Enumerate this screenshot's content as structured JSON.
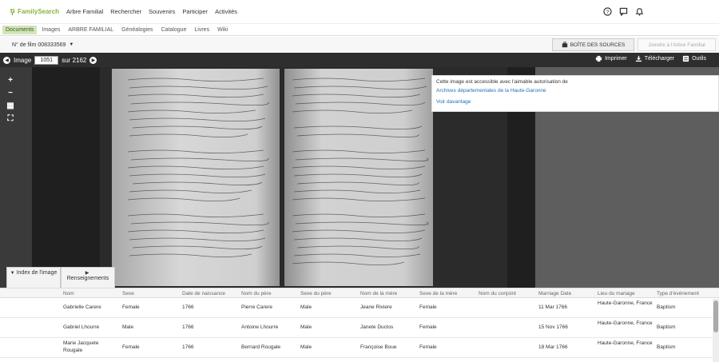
{
  "brand": {
    "name": "FamilySearch",
    "color": "#87b540"
  },
  "nav": {
    "items": [
      "Arbre Familial",
      "Rechercher",
      "Souvenirs",
      "Participer",
      "Activités"
    ]
  },
  "top_icons": [
    "help-icon",
    "message-icon",
    "bell-icon"
  ],
  "subnav": {
    "items": [
      "Documents",
      "Images",
      "ARBRE FAMILIAL",
      "Généalogies",
      "Catalogue",
      "Livres",
      "Wiki"
    ],
    "active": "Documents"
  },
  "film": {
    "label": "N° de film 008333569",
    "sources_button": "BOÎTE DES SOURCES",
    "join_button": "Joindre à l'Arbre Familial"
  },
  "image_bar": {
    "image_label": "Image",
    "image_number": "1051",
    "of_label": "sur 2162",
    "print": "Imprimer",
    "download": "Télécharger",
    "tools": "Outils"
  },
  "viewer_tools": [
    "+",
    "−",
    "▦",
    "⛶"
  ],
  "popup": {
    "text": "Cette image est accessible avec l'aimable autorisation de",
    "link": "Archives départementales de la Haute-Garonne",
    "more": "Voir davantage"
  },
  "tabs": {
    "index": "Index de l'image",
    "info": "Renseignements"
  },
  "table": {
    "headers": [
      "Nom",
      "Sexe",
      "Date de naissance",
      "Nom du père",
      "Sexe du père",
      "Nom de la mère",
      "Sexe de la mère",
      "Nom du conjoint",
      "Marriage Date",
      "Lieu du mariage",
      "Type d'événement"
    ],
    "rows": [
      {
        "nom": "Gabrielle Carere",
        "sexe": "Female",
        "date": "1766",
        "pere": "Pierre Carere",
        "sexe_pere": "Male",
        "mere": "Jeane Riviere",
        "sexe_mere": "Female",
        "conjoint": "",
        "mdate": "11 Mar 1766",
        "lieu": "Haute-Garonne, France",
        "type": "Baptism"
      },
      {
        "nom": "Gabriel Lhourre",
        "sexe": "Male",
        "date": "1766",
        "pere": "Antoine Lhourre",
        "sexe_pere": "Male",
        "mere": "Janete Duclos",
        "sexe_mere": "Female",
        "conjoint": "",
        "mdate": "15 Nov 1766",
        "lieu": "Haute-Garonne, France",
        "type": "Baptism"
      },
      {
        "nom": "Marie Jacquete Rougale",
        "sexe": "Female",
        "date": "1766",
        "pere": "Bernard Rougale",
        "sexe_pere": "Male",
        "mere": "Françoise Boue",
        "sexe_mere": "Female",
        "conjoint": "",
        "mdate": "18 Mar 1766",
        "lieu": "Haute-Garonne, France",
        "type": "Baptism"
      }
    ]
  }
}
